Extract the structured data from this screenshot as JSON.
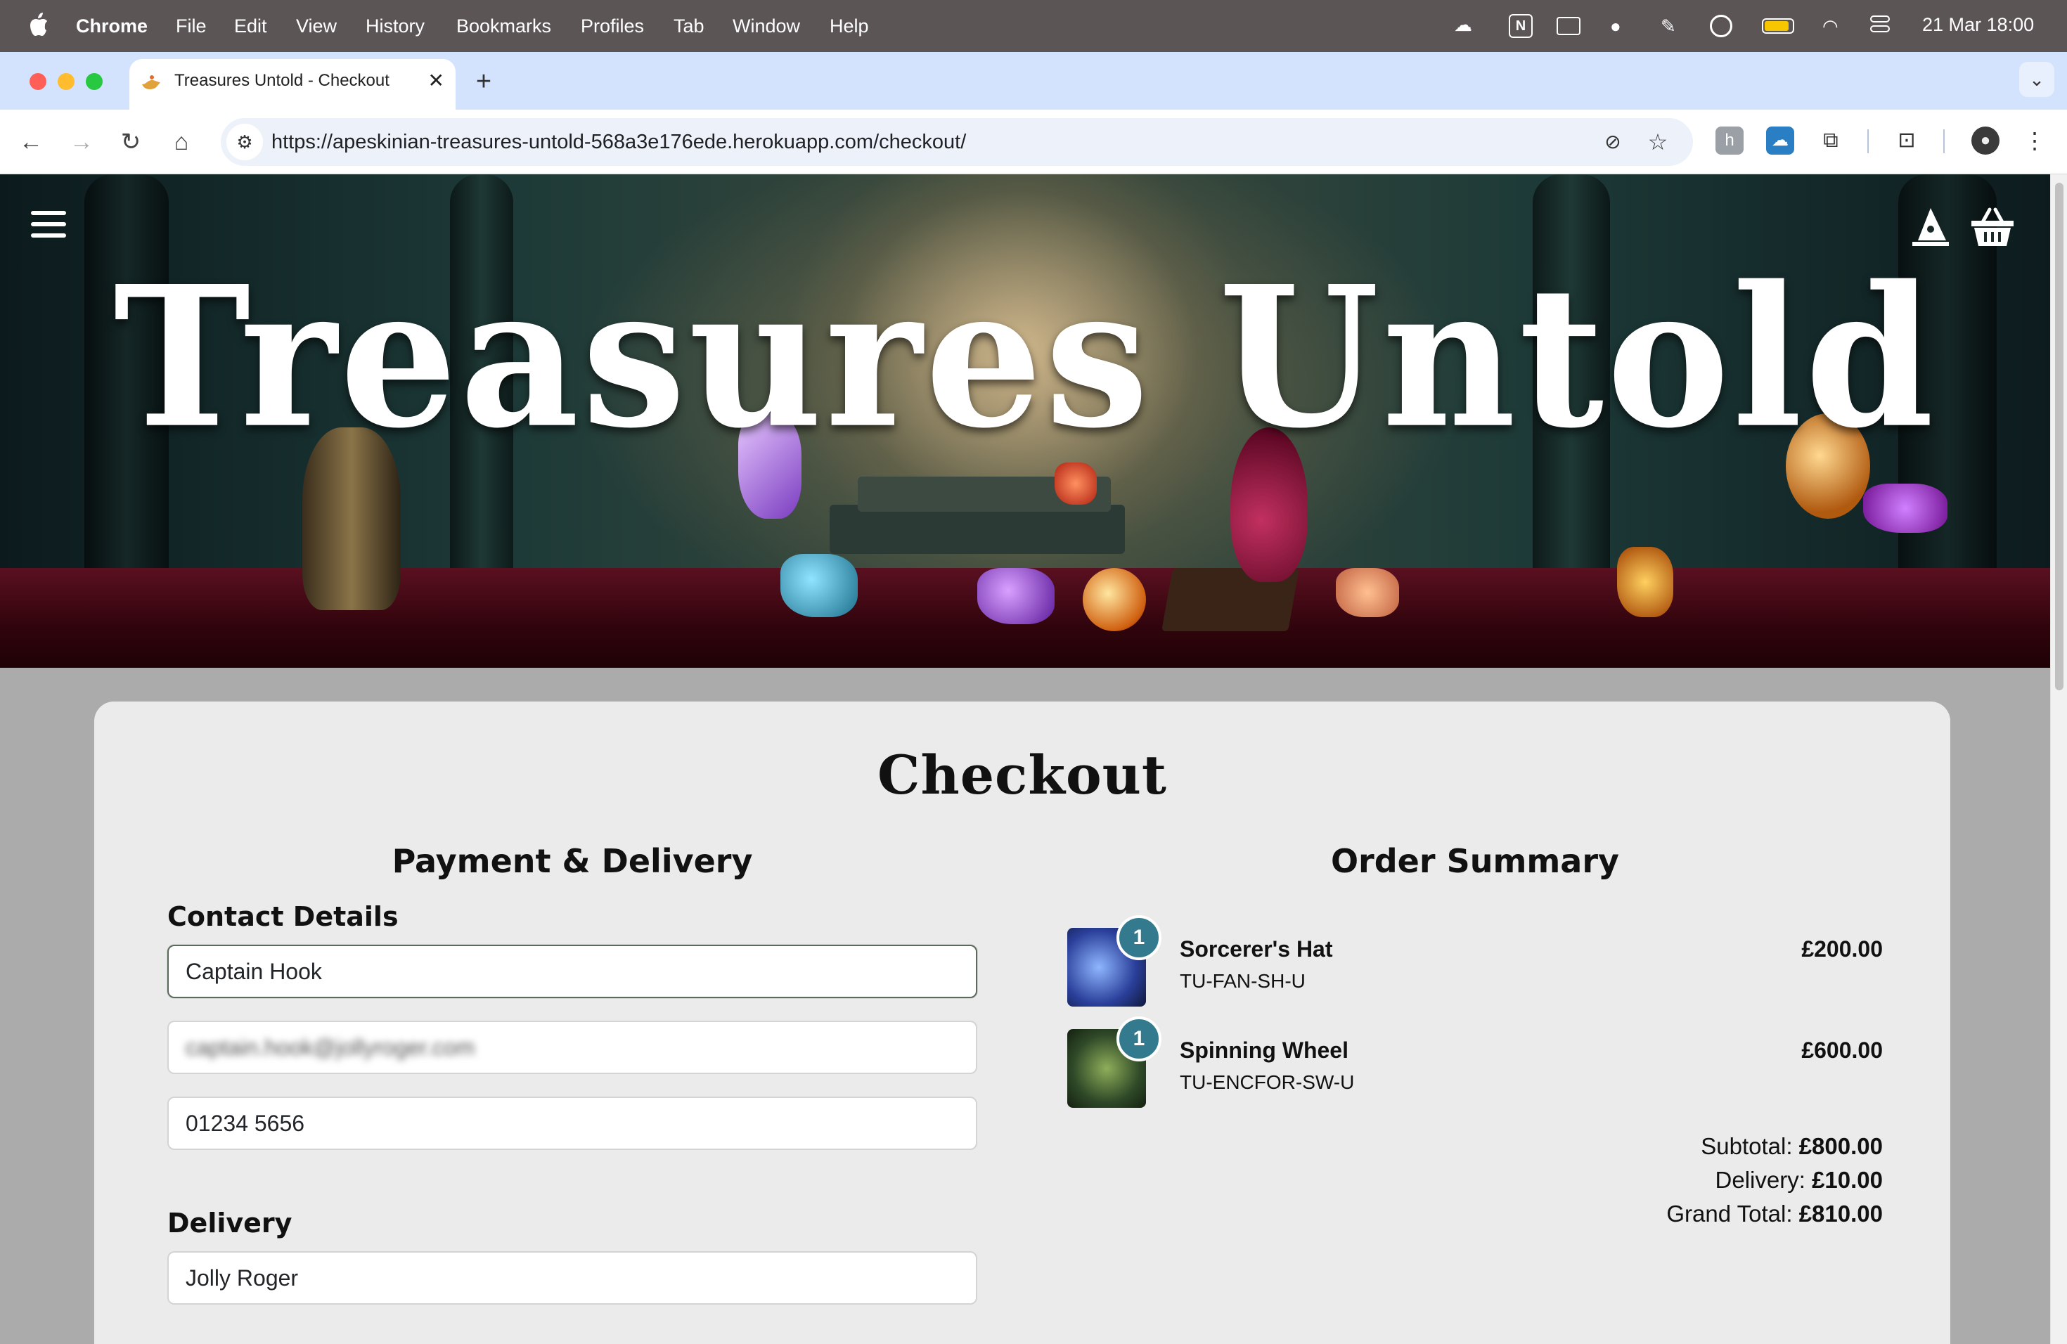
{
  "menubar": {
    "app": "Chrome",
    "items": [
      "File",
      "Edit",
      "View",
      "History",
      "Bookmarks",
      "Profiles",
      "Tab",
      "Window",
      "Help"
    ],
    "clock": "21 Mar  18:00"
  },
  "browser": {
    "tab_title": "Treasures Untold - Checkout",
    "url": "https://apeskinian-treasures-untold-568a3e176ede.herokuapp.com/checkout/"
  },
  "site": {
    "logo": "Treasures Untold"
  },
  "checkout": {
    "title": "Checkout",
    "payment_heading": "Payment & Delivery",
    "contact_heading": "Contact Details",
    "full_name": "Captain Hook",
    "email_blurred": "captain.hook@jollyroger.com",
    "phone": "01234 5656",
    "delivery_heading": "Delivery",
    "address_line": "Jolly Roger"
  },
  "summary": {
    "heading": "Order Summary",
    "items": [
      {
        "name": "Sorcerer's Hat",
        "sku": "TU-FAN-SH-U",
        "qty": "1",
        "price": "£200.00"
      },
      {
        "name": "Spinning Wheel",
        "sku": "TU-ENCFOR-SW-U",
        "qty": "1",
        "price": "£600.00"
      }
    ],
    "subtotal_label": "Subtotal:",
    "subtotal": "£800.00",
    "delivery_label": "Delivery:",
    "delivery": "£10.00",
    "grand_total_label": "Grand Total:",
    "grand_total": "£810.00"
  },
  "colors": {
    "qty_badge": "#347a8e",
    "card_bg": "#ebebeb",
    "tabstrip": "#d3e3fd"
  }
}
